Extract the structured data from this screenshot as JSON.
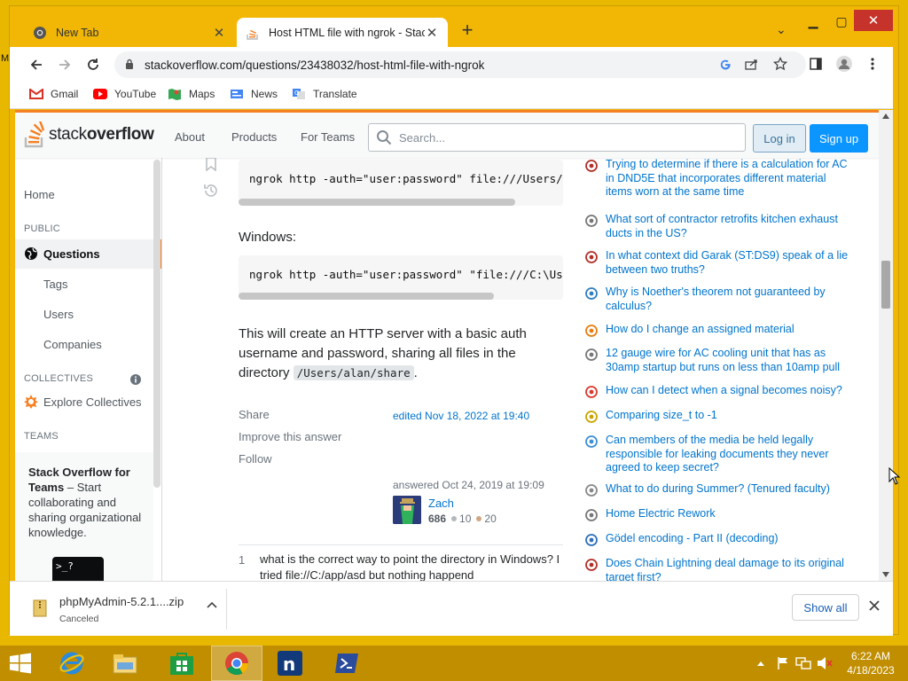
{
  "desktop": {
    "side_label": "M"
  },
  "browser": {
    "tabs": [
      {
        "title": "New Tab",
        "icon": "chrome-icon",
        "active": false
      },
      {
        "title": "Host HTML file with ngrok - Stack",
        "icon": "stackoverflow-icon",
        "active": true
      }
    ],
    "url": "stackoverflow.com/questions/23438032/host-html-file-with-ngrok",
    "bookmarks": [
      {
        "label": "Gmail",
        "icon": "gmail-icon"
      },
      {
        "label": "YouTube",
        "icon": "youtube-icon"
      },
      {
        "label": "Maps",
        "icon": "maps-icon"
      },
      {
        "label": "News",
        "icon": "news-icon"
      },
      {
        "label": "Translate",
        "icon": "translate-icon"
      }
    ]
  },
  "so_header": {
    "logo_light": "stack",
    "logo_bold": "overflow",
    "nav": [
      "About",
      "Products",
      "For Teams"
    ],
    "search_placeholder": "Search...",
    "login_label": "Log in",
    "signup_label": "Sign up"
  },
  "left_nav": {
    "home": "Home",
    "public_label": "PUBLIC",
    "questions": "Questions",
    "tags": "Tags",
    "users": "Users",
    "companies": "Companies",
    "collectives_label": "COLLECTIVES",
    "explore_collectives": "Explore Collectives",
    "teams_label": "TEAMS",
    "teams_title": "Stack Overflow for Teams",
    "teams_desc": "– Start collaborating and sharing organizational knowledge.",
    "teams_illus_text": ">_?"
  },
  "answer": {
    "code1": "ngrok http -auth=\"user:password\" file:///Users/alan/share",
    "windows_label": "Windows:",
    "code2": "ngrok http -auth=\"user:password\" \"file:///C:\\Users\\alan\\share\"",
    "para_prefix": "This will create an HTTP server with a basic auth username and password, sharing all files in the directory",
    "para_code": "/Users/alan/share",
    "para_suffix": ".",
    "menu": [
      "Share",
      "Improve this answer",
      "Follow"
    ],
    "edited": "edited Nov 18, 2022 at 19:40",
    "answered": "answered Oct 24, 2019 at 19:09",
    "user_name": "Zach",
    "user_rep": "686",
    "silver_badges": "10",
    "bronze_badges": "20",
    "comment_score": "1",
    "comment_text": "what is the correct way to point the directory in Windows? I tried file://C:/app/asd but nothing happend"
  },
  "hot_questions": [
    {
      "title": "Trying to determine if there is a calculation for AC in DND5E that incorporates different material items worn at the same time",
      "icon": "rpg-icon",
      "color": "#b2302a"
    },
    {
      "title": "What sort of contractor retrofits kitchen exhaust ducts in the US?",
      "icon": "diy-icon",
      "color": "#777777"
    },
    {
      "title": "In what context did Garak (ST:DS9) speak of a lie between two truths?",
      "icon": "scifi-icon",
      "color": "#b2302a"
    },
    {
      "title": "Why is Noether's theorem not guaranteed by calculus?",
      "icon": "physics-icon",
      "color": "#2f7fc1"
    },
    {
      "title": "How do I change an assigned material",
      "icon": "blender-icon",
      "color": "#e87d0d"
    },
    {
      "title": "12 gauge wire for AC cooling unit that has as 30amp startup but runs on less than 10amp pull",
      "icon": "diy-icon",
      "color": "#777777"
    },
    {
      "title": "How can I detect when a signal becomes noisy?",
      "icon": "dsp-icon",
      "color": "#d73a2f"
    },
    {
      "title": "Comparing size_t to -1",
      "icon": "codereview-icon",
      "color": "#c8a400"
    },
    {
      "title": "Can members of the media be held legally responsible for leaking documents they never agreed to keep secret?",
      "icon": "law-icon",
      "color": "#3d8fd6"
    },
    {
      "title": "What to do during Summer? (Tenured faculty)",
      "icon": "academia-icon",
      "color": "#888888"
    },
    {
      "title": "Home Electric Rework",
      "icon": "diy-icon",
      "color": "#777777"
    },
    {
      "title": "Gödel encoding - Part II (decoding)",
      "icon": "codegolf-icon",
      "color": "#2e6fbb"
    },
    {
      "title": "Does Chain Lightning deal damage to its original target first?",
      "icon": "rpg-icon",
      "color": "#b2302a"
    }
  ],
  "download": {
    "file_name": "phpMyAdmin-5.2.1....zip",
    "status": "Canceled",
    "show_all": "Show all"
  },
  "taskbar": {
    "time": "6:22 AM",
    "date": "4/18/2023"
  }
}
